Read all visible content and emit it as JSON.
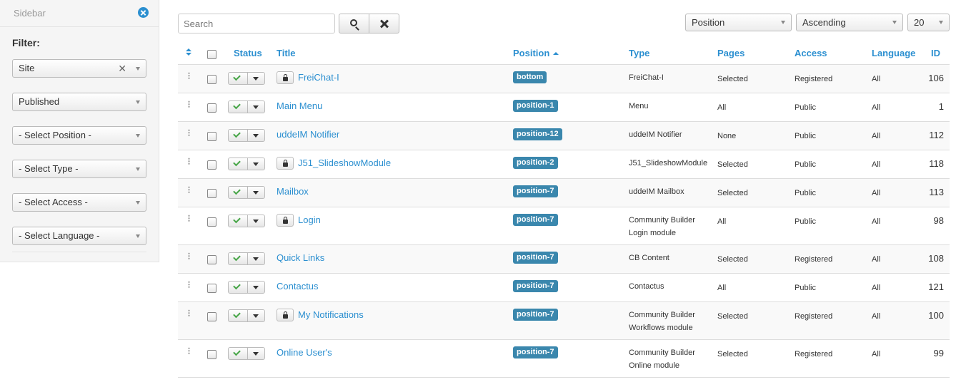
{
  "sidebar": {
    "title": "Sidebar",
    "filter_label": "Filter:",
    "filters": [
      {
        "label": "Site",
        "clearable": true
      },
      {
        "label": "Published"
      },
      {
        "label": "- Select Position -"
      },
      {
        "label": "- Select Type -"
      },
      {
        "label": "- Select Access -"
      },
      {
        "label": "- Select Language -"
      }
    ]
  },
  "toolbar": {
    "search_placeholder": "Search",
    "sort_field": "Position",
    "sort_direction": "Ascending",
    "limit": "20"
  },
  "table": {
    "headers": {
      "status": "Status",
      "title": "Title",
      "position": "Position",
      "type": "Type",
      "pages": "Pages",
      "access": "Access",
      "language": "Language",
      "id": "ID"
    },
    "rows": [
      {
        "title": "FreiChat-I",
        "locked": true,
        "position": "bottom",
        "type": "FreiChat-I",
        "pages": "Selected",
        "access": "Registered",
        "language": "All",
        "id": "106"
      },
      {
        "title": "Main Menu",
        "locked": false,
        "position": "position-1",
        "type": "Menu",
        "pages": "All",
        "access": "Public",
        "language": "All",
        "id": "1"
      },
      {
        "title": "uddeIM Notifier",
        "locked": false,
        "position": "position-12",
        "type": "uddeIM Notifier",
        "pages": "None",
        "access": "Public",
        "language": "All",
        "id": "112"
      },
      {
        "title": "J51_SlideshowModule",
        "locked": true,
        "position": "position-2",
        "type": "J51_SlideshowModule",
        "pages": "Selected",
        "access": "Public",
        "language": "All",
        "id": "118"
      },
      {
        "title": "Mailbox",
        "locked": false,
        "position": "position-7",
        "type": "uddeIM Mailbox",
        "pages": "Selected",
        "access": "Public",
        "language": "All",
        "id": "113"
      },
      {
        "title": "Login",
        "locked": true,
        "position": "position-7",
        "type": "Community Builder Login module",
        "pages": "All",
        "access": "Public",
        "language": "All",
        "id": "98"
      },
      {
        "title": "Quick Links",
        "locked": false,
        "position": "position-7",
        "type": "CB Content",
        "pages": "Selected",
        "access": "Registered",
        "language": "All",
        "id": "108"
      },
      {
        "title": "Contactus",
        "locked": false,
        "position": "position-7",
        "type": "Contactus",
        "pages": "All",
        "access": "Public",
        "language": "All",
        "id": "121"
      },
      {
        "title": "My Notifications",
        "locked": true,
        "position": "position-7",
        "type": "Community Builder Workflows module",
        "pages": "Selected",
        "access": "Registered",
        "language": "All",
        "id": "100"
      },
      {
        "title": "Online User's",
        "locked": false,
        "position": "position-7",
        "type": "Community Builder Online module",
        "pages": "Selected",
        "access": "Registered",
        "language": "All",
        "id": "99"
      }
    ]
  }
}
